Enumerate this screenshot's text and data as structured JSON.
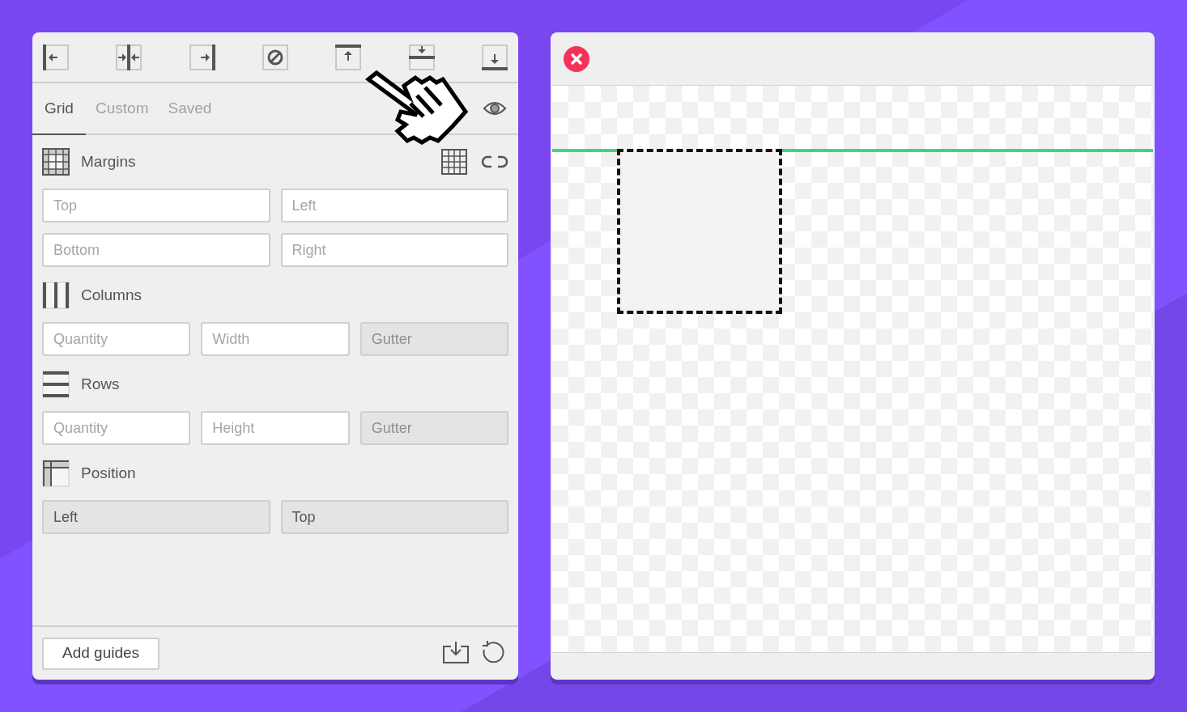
{
  "tabs": [
    {
      "label": "Grid",
      "selected": true
    },
    {
      "label": "Custom",
      "selected": false
    },
    {
      "label": "Saved",
      "selected": false
    }
  ],
  "sections": [
    {
      "kind": "margins",
      "title": "Margins",
      "fields": [
        {
          "placeholder": "Top",
          "disabled": false
        },
        {
          "placeholder": "Left",
          "disabled": false
        },
        {
          "placeholder": "Bottom",
          "disabled": false
        },
        {
          "placeholder": "Right",
          "disabled": false
        }
      ]
    },
    {
      "kind": "columns",
      "title": "Columns",
      "fields": [
        {
          "placeholder": "Quantity",
          "disabled": false
        },
        {
          "placeholder": "Width",
          "disabled": false
        },
        {
          "placeholder": "Gutter",
          "disabled": true
        }
      ]
    },
    {
      "kind": "rows",
      "title": "Rows",
      "fields": [
        {
          "placeholder": "Quantity",
          "disabled": false
        },
        {
          "placeholder": "Height",
          "disabled": false
        },
        {
          "placeholder": "Gutter",
          "disabled": true
        }
      ]
    },
    {
      "kind": "position",
      "title": "Position",
      "fields": [
        {
          "value": "Left",
          "disabled": true
        },
        {
          "value": "Top",
          "disabled": true
        }
      ]
    }
  ],
  "footer": {
    "button": "Add guides"
  }
}
